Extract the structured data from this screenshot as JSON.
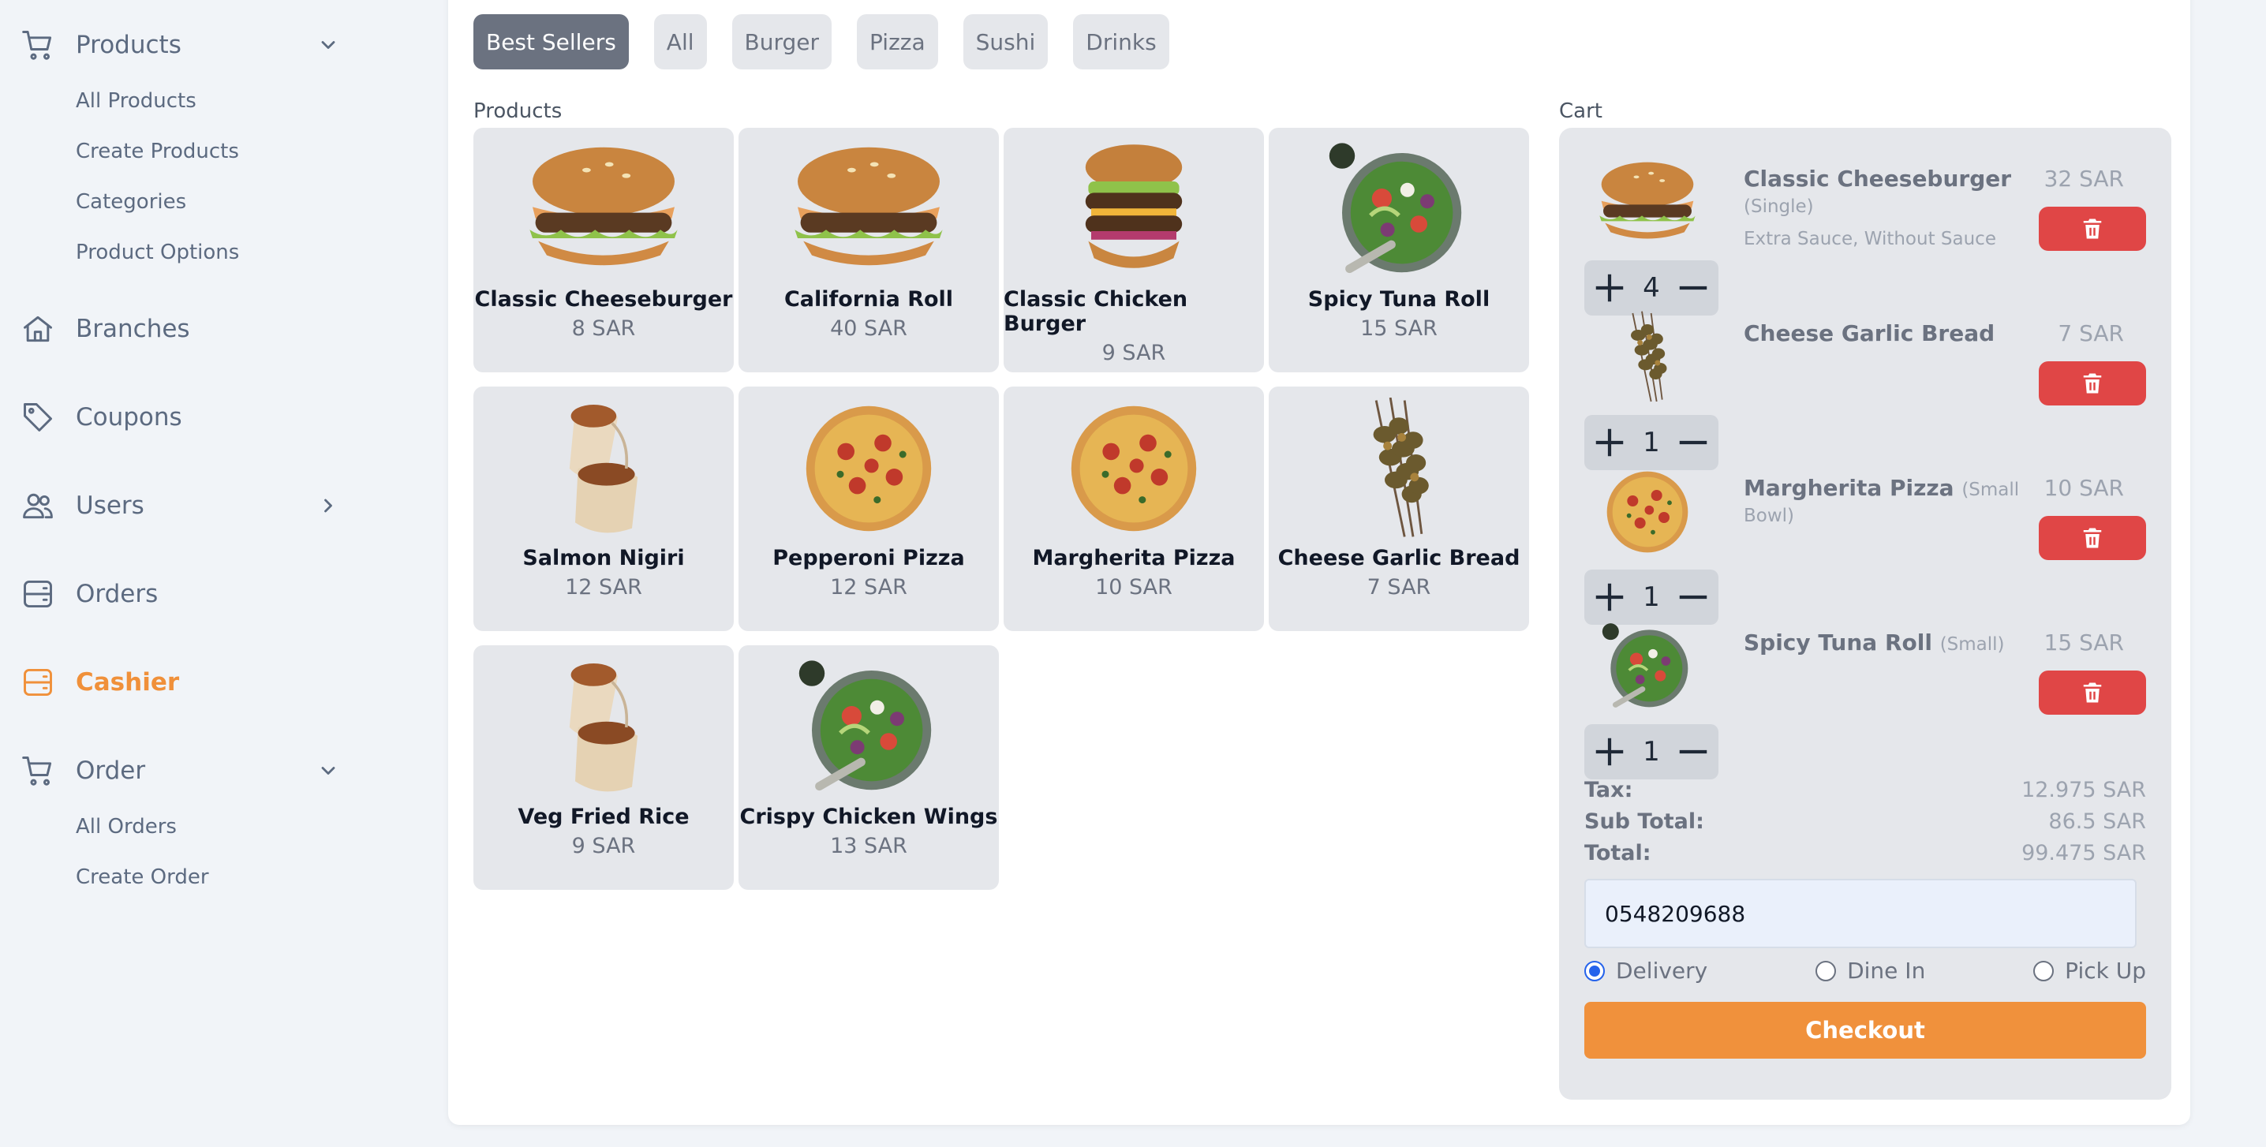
{
  "colors": {
    "accent": "#f0913c",
    "danger": "#e04646",
    "sidebar_text": "#5c6a80"
  },
  "sidebar": {
    "products": {
      "label": "Products",
      "icon": "cart-icon",
      "items": [
        "All Products",
        "Create Products",
        "Categories",
        "Product Options"
      ]
    },
    "branches": {
      "label": "Branches",
      "icon": "home-icon"
    },
    "coupons": {
      "label": "Coupons",
      "icon": "tag-icon"
    },
    "users": {
      "label": "Users",
      "icon": "users-icon"
    },
    "orders": {
      "label": "Orders",
      "icon": "server-icon"
    },
    "cashier": {
      "label": "Cashier",
      "icon": "server-icon"
    },
    "order": {
      "label": "Order",
      "icon": "cart-icon",
      "items": [
        "All Orders",
        "Create Order"
      ]
    }
  },
  "filters": [
    "Best Sellers",
    "All",
    "Burger",
    "Pizza",
    "Sushi",
    "Drinks"
  ],
  "products_label": "Products",
  "cart_label": "Cart",
  "products": [
    {
      "name": "Classic Cheeseburger",
      "price": "8 SAR",
      "image": "burger"
    },
    {
      "name": "California Roll",
      "price": "40 SAR",
      "image": "burger"
    },
    {
      "name": "Classic Chicken Burger",
      "price": "9 SAR",
      "image": "tall-burger"
    },
    {
      "name": "Spicy Tuna Roll",
      "price": "15 SAR",
      "image": "salad"
    },
    {
      "name": "Salmon Nigiri",
      "price": "12 SAR",
      "image": "wrap"
    },
    {
      "name": "Pepperoni Pizza",
      "price": "12 SAR",
      "image": "pizza"
    },
    {
      "name": "Margherita Pizza",
      "price": "10 SAR",
      "image": "pizza"
    },
    {
      "name": "Cheese Garlic Bread",
      "price": "7 SAR",
      "image": "skewers"
    },
    {
      "name": "Veg Fried Rice",
      "price": "9 SAR",
      "image": "wrap"
    },
    {
      "name": "Crispy Chicken Wings",
      "price": "13 SAR",
      "image": "salad"
    }
  ],
  "cart": {
    "items": [
      {
        "name": "Classic Cheeseburger",
        "variant": "(Single)",
        "options": "Extra Sauce, Without Sauce",
        "price": "32 SAR",
        "qty": "4",
        "image": "burger"
      },
      {
        "name": "Cheese Garlic Bread",
        "variant": "",
        "options": "",
        "price": "7 SAR",
        "qty": "1",
        "image": "skewers"
      },
      {
        "name": "Margherita Pizza",
        "variant": "(Small Bowl)",
        "options": "",
        "price": "10 SAR",
        "qty": "1",
        "image": "pizza"
      },
      {
        "name": "Spicy Tuna Roll",
        "variant": "(Small)",
        "options": "",
        "price": "15 SAR",
        "qty": "1",
        "image": "salad"
      }
    ],
    "tax_label": "Tax:",
    "tax": "12.975 SAR",
    "subtotal_label": "Sub Total:",
    "subtotal": "86.5 SAR",
    "total_label": "Total:",
    "total": "99.475 SAR",
    "phone": "0548209688",
    "order_types": [
      {
        "label": "Delivery",
        "selected": true
      },
      {
        "label": "Dine In",
        "selected": false
      },
      {
        "label": "Pick Up",
        "selected": false
      }
    ],
    "checkout_label": "Checkout"
  }
}
